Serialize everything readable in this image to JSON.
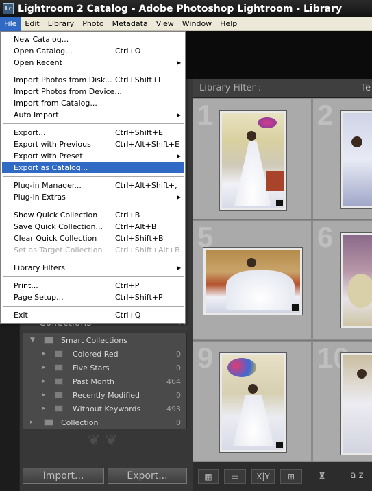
{
  "window": {
    "title": "Lightroom 2 Catalog - Adobe Photoshop Lightroom - Library",
    "icon": "Lr"
  },
  "menubar": [
    "File",
    "Edit",
    "Library",
    "Photo",
    "Metadata",
    "View",
    "Window",
    "Help"
  ],
  "file_menu": {
    "items": [
      {
        "label": "New Catalog...",
        "shortcut": ""
      },
      {
        "label": "Open Catalog...",
        "shortcut": "Ctrl+O"
      },
      {
        "label": "Open Recent",
        "shortcut": ""
      },
      {
        "label": "Import Photos from Disk...",
        "shortcut": "Ctrl+Shift+I"
      },
      {
        "label": "Import Photos from Device...",
        "shortcut": ""
      },
      {
        "label": "Import from Catalog...",
        "shortcut": ""
      },
      {
        "label": "Auto Import",
        "shortcut": ""
      },
      {
        "label": "Export...",
        "shortcut": "Ctrl+Shift+E"
      },
      {
        "label": "Export with Previous",
        "shortcut": "Ctrl+Alt+Shift+E"
      },
      {
        "label": "Export with Preset",
        "shortcut": ""
      },
      {
        "label": "Export as Catalog...",
        "shortcut": ""
      },
      {
        "label": "Plug-in Manager...",
        "shortcut": "Ctrl+Alt+Shift+,"
      },
      {
        "label": "Plug-in Extras",
        "shortcut": ""
      },
      {
        "label": "Show Quick Collection",
        "shortcut": "Ctrl+B"
      },
      {
        "label": "Save Quick Collection...",
        "shortcut": "Ctrl+Alt+B"
      },
      {
        "label": "Clear Quick Collection",
        "shortcut": "Ctrl+Shift+B"
      },
      {
        "label": "Set as Target Collection",
        "shortcut": "Ctrl+Shift+Alt+B"
      },
      {
        "label": "Library Filters",
        "shortcut": ""
      },
      {
        "label": "Print...",
        "shortcut": "Ctrl+P"
      },
      {
        "label": "Page Setup...",
        "shortcut": "Ctrl+Shift+P"
      },
      {
        "label": "Exit",
        "shortcut": "Ctrl+Q"
      }
    ]
  },
  "library_filter": {
    "label": "Library Filter :",
    "right_text": "Te"
  },
  "grid": {
    "numbers": [
      "1",
      "2",
      "5",
      "6",
      "9",
      "10"
    ]
  },
  "collections": {
    "header": "Collections",
    "add_button": "+.",
    "smart_collections": "Smart Collections",
    "rows": [
      {
        "label": "Colored Red",
        "count": "0"
      },
      {
        "label": "Five Stars",
        "count": "0"
      },
      {
        "label": "Past Month",
        "count": "464"
      },
      {
        "label": "Recently Modified",
        "count": "0"
      },
      {
        "label": "Without Keywords",
        "count": "493"
      }
    ],
    "collection": {
      "label": "Collection",
      "count": "0"
    }
  },
  "buttons": {
    "import": "Import...",
    "export": "Export..."
  },
  "toolbar": {
    "xy": "X|Y",
    "sort": "a z"
  },
  "colors": {
    "highlight": "#316ac5",
    "menubar_bg": "#ece9d8"
  }
}
